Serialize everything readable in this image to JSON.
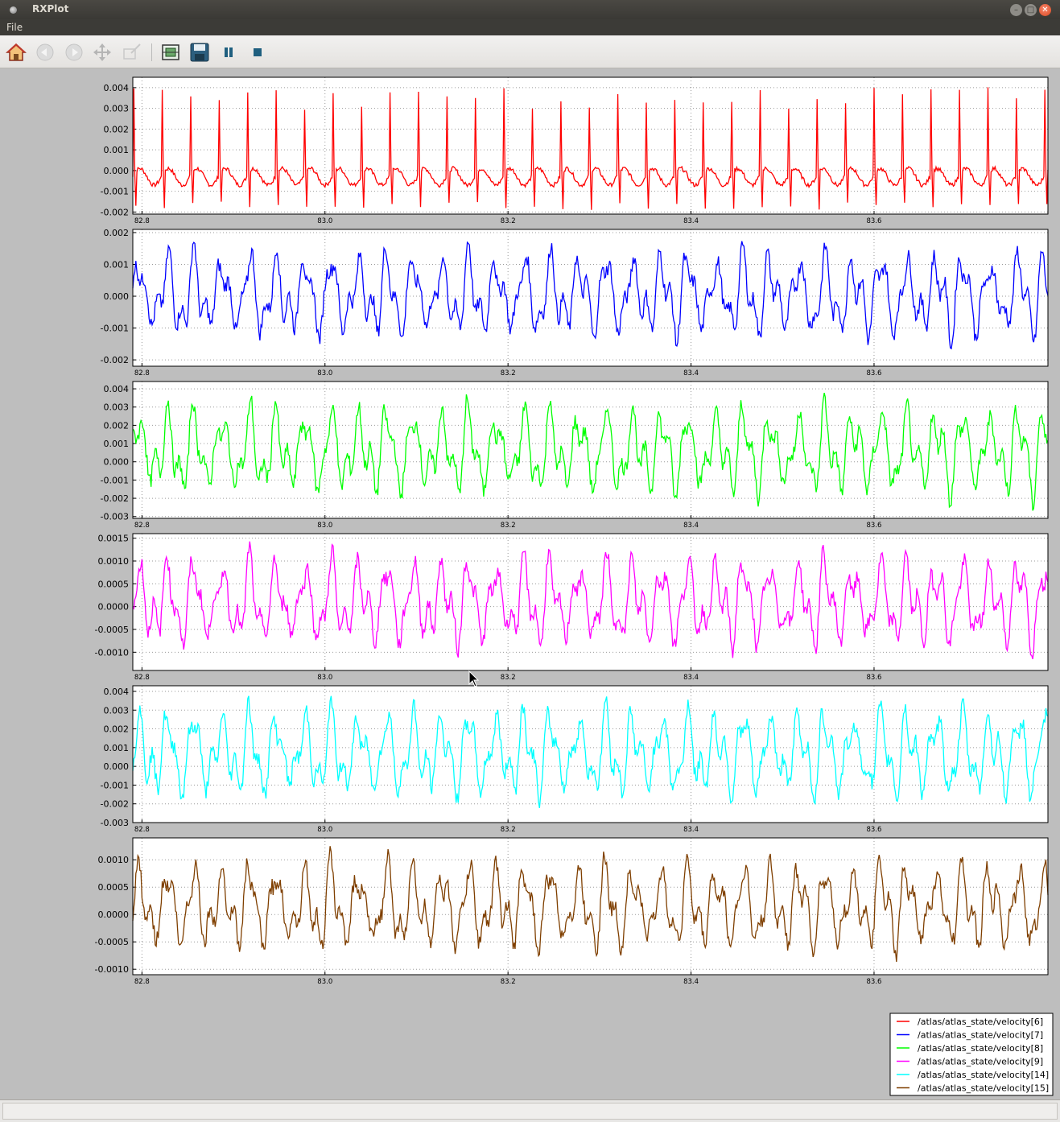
{
  "window": {
    "title": "RXPlot",
    "minimize_glyph": "–",
    "maximize_glyph": "□",
    "close_glyph": "✕"
  },
  "menubar": {
    "file_label": "File"
  },
  "toolbar": {
    "icons": [
      "home-icon",
      "back-icon",
      "forward-icon",
      "pan-icon",
      "zoom-icon",
      "configure-subplots-icon",
      "save-icon",
      "pause-icon",
      "stop-icon"
    ]
  },
  "colors": {
    "velocity_6": "#ff0000",
    "velocity_7": "#0000ff",
    "velocity_8": "#00ff00",
    "velocity_9": "#ff00ff",
    "velocity_14": "#00ffff",
    "velocity_15": "#7f3f00"
  },
  "chart_data": [
    {
      "type": "line",
      "series": [
        {
          "name": "/atlas/atlas_state/velocity[6]",
          "color": "#ff0000",
          "x_range": [
            82.79,
            83.79
          ],
          "approx_y_range": [
            -0.0019,
            0.0041
          ],
          "pattern": "periodic spikes"
        }
      ],
      "xlim": [
        82.79,
        83.79
      ],
      "ylim": [
        -0.0021,
        0.0045
      ],
      "xticks": [
        "82.8",
        "83.0",
        "83.2",
        "83.4",
        "83.6"
      ],
      "yticks": [
        "0.004",
        "0.003",
        "0.002",
        "0.001",
        "0.000",
        "-0.001",
        "-0.002"
      ],
      "grid": true
    },
    {
      "type": "line",
      "series": [
        {
          "name": "/atlas/atlas_state/velocity[7]",
          "color": "#0000ff",
          "x_range": [
            82.79,
            83.79
          ],
          "approx_y_range": [
            -0.0019,
            0.002
          ]
        }
      ],
      "xlim": [
        82.79,
        83.79
      ],
      "ylim": [
        -0.0022,
        0.0021
      ],
      "xticks": [
        "82.8",
        "83.0",
        "83.2",
        "83.4",
        "83.6"
      ],
      "yticks": [
        "0.002",
        "0.001",
        "0.000",
        "-0.001",
        "-0.002"
      ],
      "grid": true
    },
    {
      "type": "line",
      "series": [
        {
          "name": "/atlas/atlas_state/velocity[8]",
          "color": "#00ff00",
          "x_range": [
            82.79,
            83.79
          ],
          "approx_y_range": [
            -0.0029,
            0.0041
          ]
        }
      ],
      "xlim": [
        82.79,
        83.79
      ],
      "ylim": [
        -0.0031,
        0.0044
      ],
      "xticks": [
        "82.8",
        "83.0",
        "83.2",
        "83.4",
        "83.6"
      ],
      "yticks": [
        "0.004",
        "0.003",
        "0.002",
        "0.001",
        "0.000",
        "-0.001",
        "-0.002",
        "-0.003"
      ],
      "grid": true
    },
    {
      "type": "line",
      "series": [
        {
          "name": "/atlas/atlas_state/velocity[9]",
          "color": "#ff00ff",
          "x_range": [
            82.79,
            83.79
          ],
          "approx_y_range": [
            -0.0013,
            0.0015
          ]
        }
      ],
      "xlim": [
        82.79,
        83.79
      ],
      "ylim": [
        -0.0014,
        0.0016
      ],
      "xticks": [
        "82.8",
        "83.0",
        "83.2",
        "83.4",
        "83.6"
      ],
      "yticks": [
        "0.0015",
        "0.0010",
        "0.0005",
        "0.0000",
        "-0.0005",
        "-0.0010"
      ],
      "grid": true
    },
    {
      "type": "line",
      "series": [
        {
          "name": "/atlas/atlas_state/velocity[14]",
          "color": "#00ffff",
          "x_range": [
            82.79,
            83.79
          ],
          "approx_y_range": [
            -0.0027,
            0.0041
          ]
        }
      ],
      "xlim": [
        82.79,
        83.79
      ],
      "ylim": [
        -0.003,
        0.0043
      ],
      "xticks": [
        "82.8",
        "83.0",
        "83.2",
        "83.4",
        "83.6"
      ],
      "yticks": [
        "0.004",
        "0.003",
        "0.002",
        "0.001",
        "0.000",
        "-0.001",
        "-0.002",
        "-0.003"
      ],
      "grid": true
    },
    {
      "type": "line",
      "series": [
        {
          "name": "/atlas/atlas_state/velocity[15]",
          "color": "#7f3f00",
          "x_range": [
            82.79,
            83.79
          ],
          "approx_y_range": [
            -0.001,
            0.0013
          ]
        }
      ],
      "xlim": [
        82.79,
        83.79
      ],
      "ylim": [
        -0.0011,
        0.0014
      ],
      "xticks": [
        "82.8",
        "83.0",
        "83.2",
        "83.4",
        "83.6"
      ],
      "yticks": [
        "0.0010",
        "0.0005",
        "0.0000",
        "-0.0005",
        "-0.0010"
      ],
      "grid": true
    }
  ],
  "legend": {
    "placement": "bottom-right",
    "entries": [
      {
        "label": "/atlas/atlas_state/velocity[6]",
        "color": "#ff0000"
      },
      {
        "label": "/atlas/atlas_state/velocity[7]",
        "color": "#0000ff"
      },
      {
        "label": "/atlas/atlas_state/velocity[8]",
        "color": "#00ff00"
      },
      {
        "label": "/atlas/atlas_state/velocity[9]",
        "color": "#ff00ff"
      },
      {
        "label": "/atlas/atlas_state/velocity[14]",
        "color": "#00ffff"
      },
      {
        "label": "/atlas/atlas_state/velocity[15]",
        "color": "#7f3f00"
      }
    ]
  },
  "statusbar": {
    "text": ""
  }
}
